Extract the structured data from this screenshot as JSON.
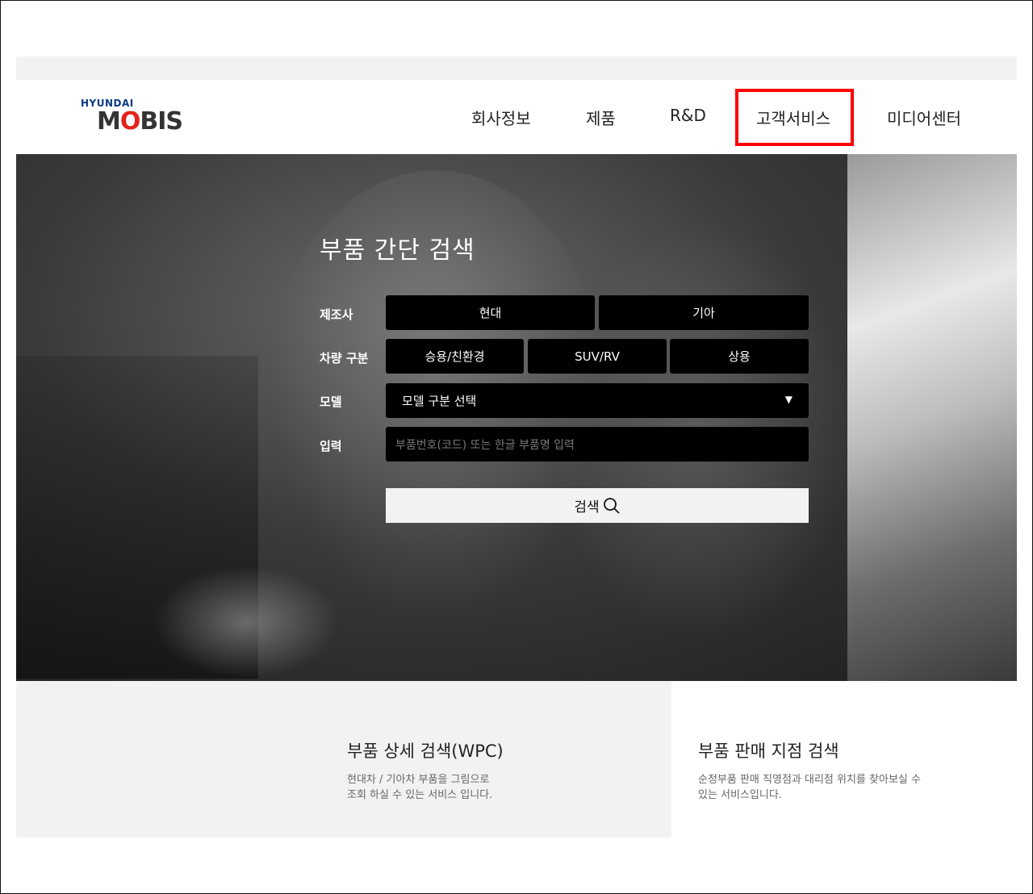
{
  "logo": {
    "top": "HYUNDAI",
    "main_pre": "M",
    "main_o": "O",
    "main_post": "BIS"
  },
  "nav": {
    "items": [
      {
        "label": "회사정보"
      },
      {
        "label": "제품"
      },
      {
        "label": "R&D"
      },
      {
        "label": "고객서비스"
      },
      {
        "label": "미디어센터"
      }
    ],
    "highlight_color": "#ff0000"
  },
  "search": {
    "title": "부품 간단 검색",
    "manufacturer_label": "제조사",
    "manufacturers": [
      "현대",
      "기아"
    ],
    "vehicle_type_label": "차량 구분",
    "vehicle_types": [
      "승용/친환경",
      "SUV/RV",
      "상용"
    ],
    "model_label": "모델",
    "model_select_value": "모델 구분 선택",
    "input_label": "입력",
    "input_placeholder": "부품번호(코드) 또는 한글 부품명 입력",
    "button_label": "검색"
  },
  "cards": {
    "wpc": {
      "title": "부품 상세 검색(WPC)",
      "desc_line1": "현대차 / 기아차 부품을 그림으로",
      "desc_line2": "조회 하실 수 있는 서비스 입니다."
    },
    "branch": {
      "title": "부품 판매 지점 검색",
      "desc_line1": "순정부품 판매 직영점과 대리점 위치를 찾아보실 수",
      "desc_line2": "있는 서비스입니다."
    }
  },
  "colors": {
    "hero_bg": "#2a2a2a",
    "pill_bg": "#000000",
    "light_bg": "#f2f2f2"
  }
}
